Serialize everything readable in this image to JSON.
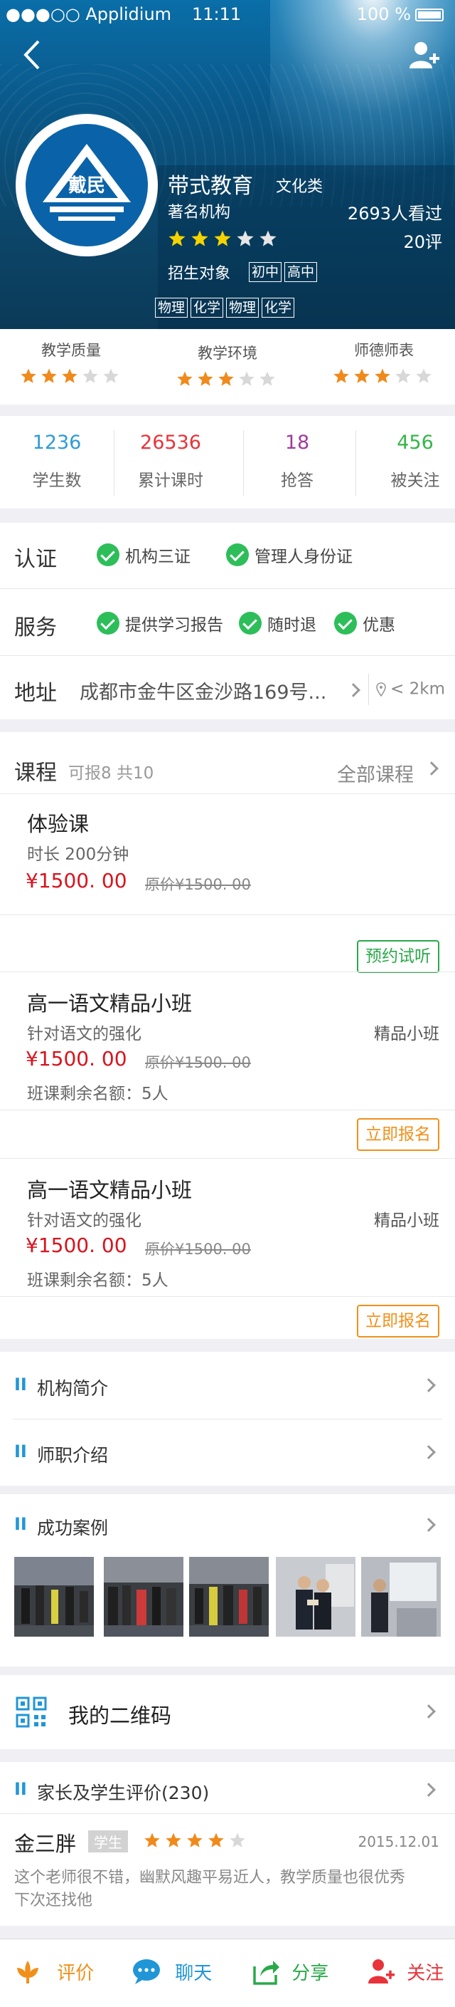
{
  "status_bar": {
    "carrier": "●●●○○ Applidium",
    "time": "11:11",
    "battery": "100 %"
  },
  "org": {
    "logo_text": "戴民",
    "name": "带式教育",
    "category": "文化类",
    "type": "著名机构",
    "views": "2693人看过",
    "rating": 3,
    "reviews": "20评",
    "target_label": "招生对象",
    "target_tags": [
      "初中",
      "高中"
    ],
    "subject_tags": [
      "物理",
      "化学",
      "物理",
      "化学"
    ]
  },
  "ratings": [
    {
      "label": "教学质量",
      "stars": 3
    },
    {
      "label": "教学环境",
      "stars": 3
    },
    {
      "label": "师德师表",
      "stars": 3
    }
  ],
  "stats": [
    {
      "value": "1236",
      "label": "学生数",
      "color": "#2e9bd6"
    },
    {
      "value": "26536",
      "label": "累计课时",
      "color": "#e8333a"
    },
    {
      "value": "18",
      "label": "抢答",
      "color": "#a03c9c"
    },
    {
      "value": "456",
      "label": "被关注",
      "color": "#35b54a"
    }
  ],
  "cert": {
    "label": "认证",
    "items": [
      "机构三证",
      "管理人身份证"
    ]
  },
  "service": {
    "label": "服务",
    "items": [
      "提供学习报告",
      "随时退",
      "优惠"
    ]
  },
  "address": {
    "label": "地址",
    "value": "成都市金牛区金沙路169号...",
    "distance": "< 2km"
  },
  "courses": {
    "title": "课程",
    "summary": "可报8 共10",
    "all_label": "全部课程",
    "items": [
      {
        "name": "体验课",
        "desc": "时长 200分钟",
        "price": "¥1500. 00",
        "orig": "原价¥1500. 00",
        "button": "预约试听",
        "btn_color": "#2aa94a"
      },
      {
        "name": "高一语文精品小班",
        "desc": "针对语文的强化",
        "type": "精品小班",
        "price": "¥1500. 00",
        "orig": "原价¥1500. 00",
        "remaining": "班课剩余名额：5人",
        "button": "立即报名",
        "btn_color": "#f0901a"
      },
      {
        "name": "高一语文精品小班",
        "desc": "针对语文的强化",
        "type": "精品小班",
        "price": "¥1500. 00",
        "orig": "原价¥1500. 00",
        "remaining": "班课剩余名额：5人",
        "button": "立即报名",
        "btn_color": "#f0901a"
      }
    ]
  },
  "sections": {
    "intro": "机构简介",
    "teachers": "师职介绍",
    "cases": "成功案例",
    "qr": "我的二维码",
    "reviews_title": "家长及学生评价(230)"
  },
  "review": {
    "user": "金三胖",
    "badge": "学生",
    "stars": 4,
    "date": "2015.12.01",
    "text_line1": "这个老师很不错，幽默风趣平易近人，教学质量也很优秀",
    "text_line2": "下次还找他"
  },
  "bottom_bar": [
    {
      "label": "评价",
      "color": "#f0901a",
      "icon": "lotus-icon"
    },
    {
      "label": "聊天",
      "color": "#2196d6",
      "icon": "chat-icon"
    },
    {
      "label": "分享",
      "color": "#2aa94a",
      "icon": "share-icon"
    },
    {
      "label": "关注",
      "color": "#e8333a",
      "icon": "add-user-icon"
    }
  ],
  "colors": {
    "brand_blue": "#0a63a8",
    "star": "#f08a1c",
    "star_off": "#d8d8d8"
  }
}
